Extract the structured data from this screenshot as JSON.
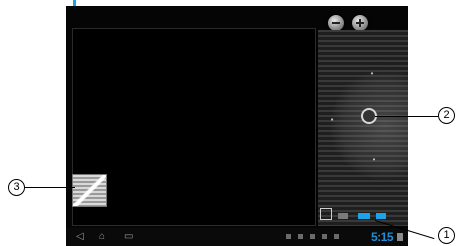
{
  "status_bar": {
    "clock": "5:15"
  },
  "callouts": [
    {
      "label": "1"
    },
    {
      "label": "2"
    },
    {
      "label": "3"
    }
  ],
  "colors": {
    "accent": "#1aa3e8",
    "clock": "#1e8fd6",
    "screen_background": "#050505"
  },
  "icons": {
    "zoom_out": "minus-icon",
    "zoom_in": "plus-icon",
    "shutter": "shutter-icon",
    "gallery": "gallery-icon",
    "back": "back-icon",
    "home": "home-icon",
    "recent": "recent-apps-icon"
  }
}
